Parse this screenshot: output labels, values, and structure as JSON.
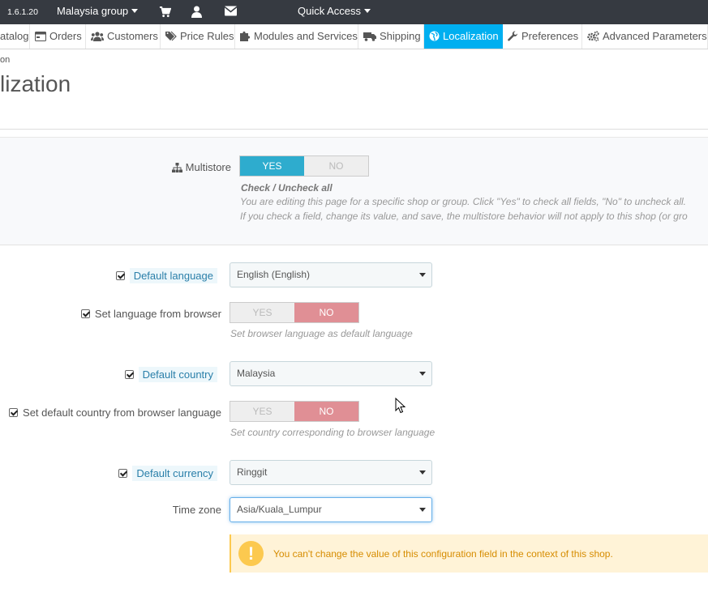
{
  "header": {
    "version": "1.6.1.20",
    "shop_selector": "Malaysia group",
    "icons": [
      "cart-icon",
      "user-icon",
      "envelope-icon"
    ],
    "quick_access": "Quick Access"
  },
  "nav": {
    "tabs": [
      {
        "label": "atalog",
        "icon": "catalog-icon"
      },
      {
        "label": "Orders",
        "icon": "orders-icon"
      },
      {
        "label": "Customers",
        "icon": "customers-icon"
      },
      {
        "label": "Price Rules",
        "icon": "tags-icon"
      },
      {
        "label": "Modules and Services",
        "icon": "puzzle-icon"
      },
      {
        "label": "Shipping",
        "icon": "truck-icon"
      },
      {
        "label": "Localization",
        "icon": "globe-icon",
        "active": true
      },
      {
        "label": "Preferences",
        "icon": "wrench-icon"
      },
      {
        "label": "Advanced Parameters",
        "icon": "cogs-icon"
      }
    ],
    "active_color": "#00aff0"
  },
  "breadcrumb": "on",
  "page_title": "lization",
  "multistore": {
    "label": "Multistore",
    "yes": "YES",
    "no": "NO",
    "selected": "YES",
    "check_title": "Check / Uncheck all",
    "help1": "You are editing this page for a specific shop or group. Click \"Yes\" to check all fields, \"No\" to uncheck all.",
    "help2": "If you check a field, change its value, and save, the multistore behavior will not apply to this shop (or gro"
  },
  "form": {
    "default_language": {
      "label": "Default language",
      "value": "English (English)"
    },
    "set_language_browser": {
      "label": "Set language from browser",
      "yes": "YES",
      "no": "NO",
      "selected": "NO",
      "help": "Set browser language as default language"
    },
    "default_country": {
      "label": "Default country",
      "value": "Malaysia"
    },
    "set_country_browser": {
      "label": "Set default country from browser language",
      "yes": "YES",
      "no": "NO",
      "selected": "NO",
      "help": "Set country corresponding to browser language"
    },
    "default_currency": {
      "label": "Default currency",
      "value": "Ringgit"
    },
    "time_zone": {
      "label": "Time zone",
      "value": "Asia/Kuala_Lumpur"
    }
  },
  "warning": {
    "icon": "!",
    "text": "You can't change the value of this configuration field in the context of this shop."
  },
  "colors": {
    "yes_on": "#2eacce",
    "no_on": "#e08f95",
    "warning_bg": "#fff3d7",
    "warning_text": "#d68c00"
  }
}
